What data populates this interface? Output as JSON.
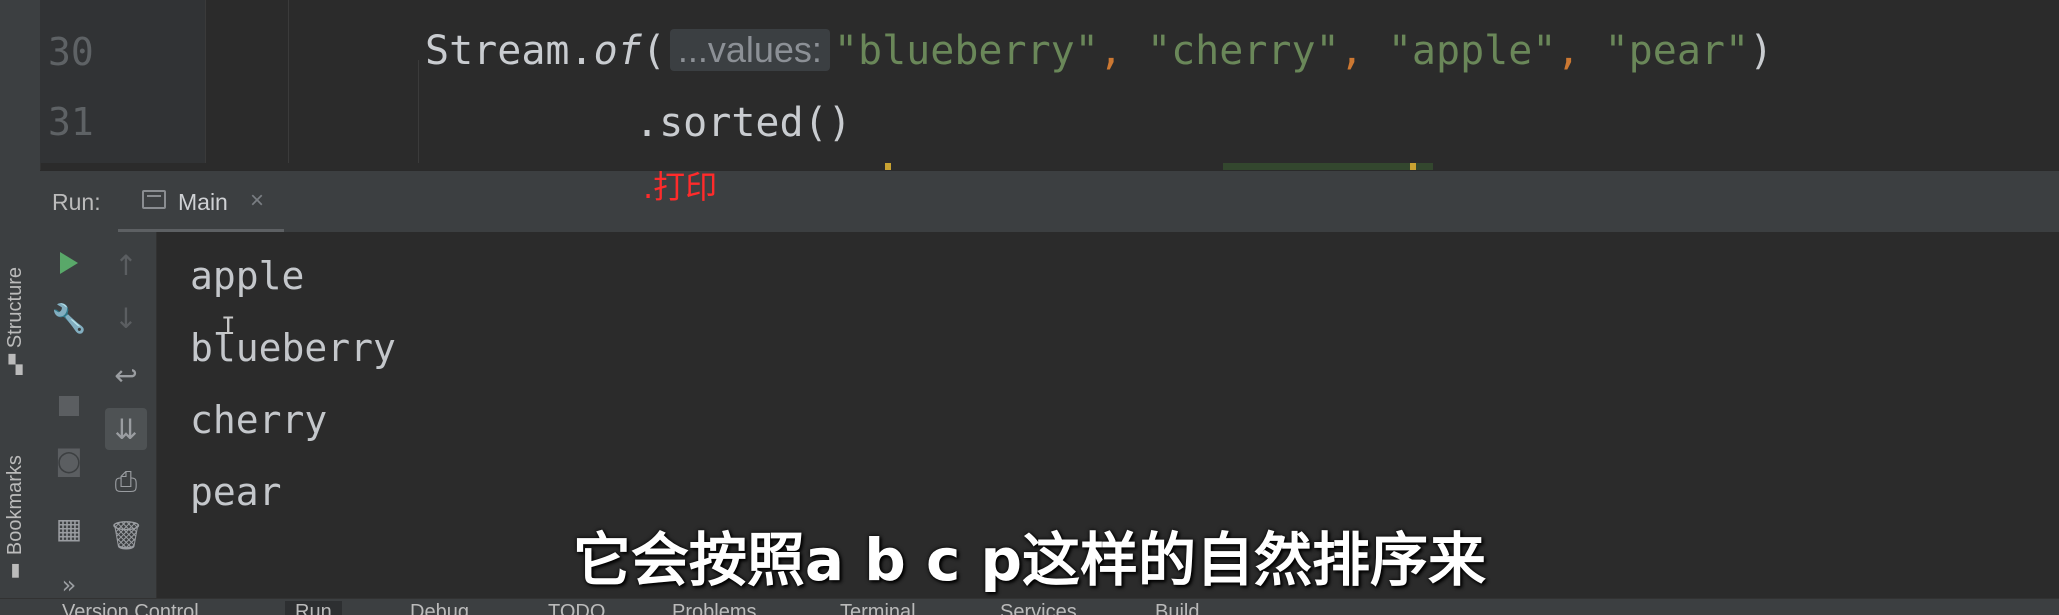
{
  "editor": {
    "line_numbers": [
      "30",
      "31"
    ],
    "line30": {
      "prefix": "Stream.",
      "method": "of",
      "open": "(",
      "hint": "...values:",
      "args": [
        "\"blueberry\"",
        "\"cherry\"",
        "\"apple\"",
        "\"pear\""
      ],
      "sep": ", ",
      "close": ")"
    },
    "line31": ".sorted()",
    "annotation": ".打印"
  },
  "run_panel": {
    "label": "Run:",
    "tab_label": "Main",
    "tab_close": "×",
    "output_lines": [
      "apple",
      "blueberry",
      "cherry",
      "pear"
    ],
    "text_cursor": "I"
  },
  "toolbar": {
    "left_icons": [
      "run-icon",
      "wrench-icon",
      "stop-icon",
      "camera-icon",
      "layout-icon",
      "more-icon"
    ],
    "right_icons": [
      "up-arrow-icon",
      "down-arrow-icon",
      "soft-wrap-icon",
      "scroll-to-end-icon",
      "print-icon",
      "trash-icon"
    ],
    "more_label": "»"
  },
  "side_tabs": {
    "structure": "Structure",
    "bookmarks": "Bookmarks"
  },
  "bottom_tabs": [
    "Version Control",
    "Run",
    "Debug",
    "TODO",
    "Problems",
    "Terminal",
    "Services",
    "Build"
  ],
  "subtitle": "它会按照a b c p这样的自然排序来",
  "colors": {
    "editor_bg": "#2b2b2b",
    "panel_bg": "#3c3f41",
    "string": "#6a8759",
    "comma": "#cc7832",
    "annotation": "#ff2b2b",
    "run_green": "#59a869"
  }
}
